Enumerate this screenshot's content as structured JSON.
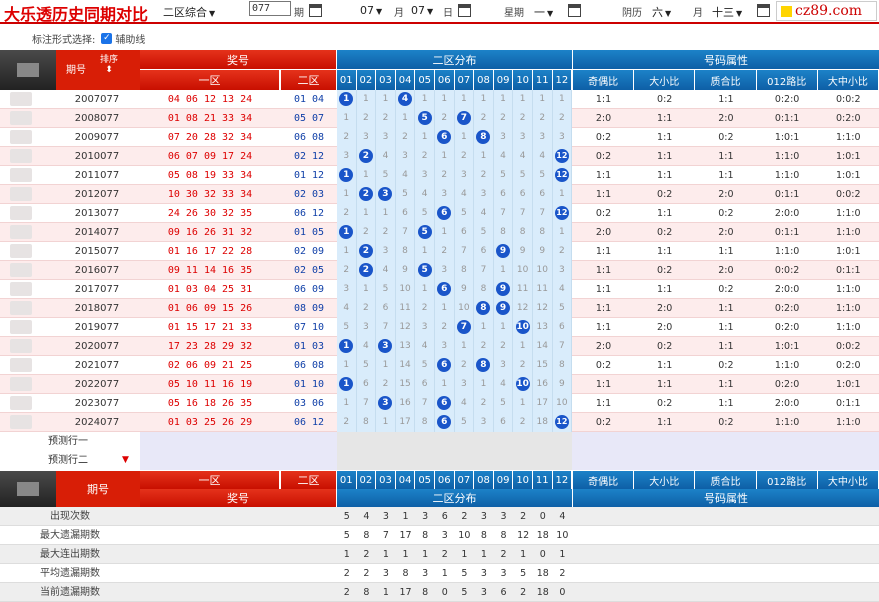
{
  "toolbar": {
    "title": "大乐透历史同期对比",
    "zone_select": "二区综合",
    "period_input": "077",
    "period_label": "期",
    "month1": "07",
    "month_label": "月",
    "day1": "07",
    "day_label": "日",
    "weekday_label": "星期",
    "weekday": "一",
    "lunar_label": "阴历",
    "lunar_month": "六",
    "lunar_month_label": "月",
    "lunar_day": "十三",
    "logo_text": "cz89.com"
  },
  "mark": {
    "label": "标注形式选择:",
    "checkbox_label": "辅助线",
    "checked": true
  },
  "header": {
    "period_col": "期号",
    "sort_label": "排序",
    "prize": "奖号",
    "zone1": "一区",
    "zone2": "二区",
    "distribution": "二区分布",
    "attributes": "号码属性",
    "numbers": [
      "01",
      "02",
      "03",
      "04",
      "05",
      "06",
      "07",
      "08",
      "09",
      "10",
      "11",
      "12"
    ],
    "attr_cols": [
      "奇偶比",
      "大小比",
      "质合比",
      "012路比",
      "大中小比"
    ]
  },
  "rows": [
    {
      "period": "2007077",
      "front": "04 06 12 13 24",
      "back": "01 04",
      "cells": [
        "1",
        "1",
        "1",
        "4",
        "1",
        "1",
        "1",
        "1",
        "1",
        "1",
        "1",
        "1"
      ],
      "balls": [
        1,
        4
      ],
      "attrs": [
        "1:1",
        "0:2",
        "1:1",
        "0:2:0",
        "0:0:2"
      ]
    },
    {
      "period": "2008077",
      "front": "01 08 21 33 34",
      "back": "05 07",
      "cells": [
        "1",
        "2",
        "2",
        "1",
        "5",
        "2",
        "7",
        "2",
        "2",
        "2",
        "2",
        "2"
      ],
      "balls": [
        5,
        7
      ],
      "attrs": [
        "2:0",
        "1:1",
        "2:0",
        "0:1:1",
        "0:2:0"
      ]
    },
    {
      "period": "2009077",
      "front": "07 20 28 32 34",
      "back": "06 08",
      "cells": [
        "2",
        "3",
        "3",
        "2",
        "1",
        "6",
        "1",
        "8",
        "3",
        "3",
        "3",
        "3"
      ],
      "balls": [
        6,
        8
      ],
      "attrs": [
        "0:2",
        "1:1",
        "0:2",
        "1:0:1",
        "1:1:0"
      ]
    },
    {
      "period": "2010077",
      "front": "06 07 09 17 24",
      "back": "02 12",
      "cells": [
        "3",
        "2",
        "4",
        "3",
        "2",
        "1",
        "2",
        "1",
        "4",
        "4",
        "4",
        "12"
      ],
      "balls": [
        2,
        12
      ],
      "attrs": [
        "0:2",
        "1:1",
        "1:1",
        "1:1:0",
        "1:0:1"
      ]
    },
    {
      "period": "2011077",
      "front": "05 08 19 33 34",
      "back": "01 12",
      "cells": [
        "1",
        "1",
        "5",
        "4",
        "3",
        "2",
        "3",
        "2",
        "5",
        "5",
        "5",
        "12"
      ],
      "balls": [
        1,
        12
      ],
      "attrs": [
        "1:1",
        "1:1",
        "1:1",
        "1:1:0",
        "1:0:1"
      ]
    },
    {
      "period": "2012077",
      "front": "10 30 32 33 34",
      "back": "02 03",
      "cells": [
        "1",
        "2",
        "3",
        "5",
        "4",
        "3",
        "4",
        "3",
        "6",
        "6",
        "6",
        "1"
      ],
      "balls": [
        2,
        3
      ],
      "attrs": [
        "1:1",
        "0:2",
        "2:0",
        "0:1:1",
        "0:0:2"
      ]
    },
    {
      "period": "2013077",
      "front": "24 26 30 32 35",
      "back": "06 12",
      "cells": [
        "2",
        "1",
        "1",
        "6",
        "5",
        "6",
        "5",
        "4",
        "7",
        "7",
        "7",
        "12"
      ],
      "balls": [
        6,
        12
      ],
      "attrs": [
        "0:2",
        "1:1",
        "0:2",
        "2:0:0",
        "1:1:0"
      ]
    },
    {
      "period": "2014077",
      "front": "09 16 26 31 32",
      "back": "01 05",
      "cells": [
        "1",
        "2",
        "2",
        "7",
        "5",
        "1",
        "6",
        "5",
        "8",
        "8",
        "8",
        "1"
      ],
      "balls": [
        1,
        5
      ],
      "attrs": [
        "2:0",
        "0:2",
        "2:0",
        "0:1:1",
        "1:1:0"
      ]
    },
    {
      "period": "2015077",
      "front": "01 16 17 22 28",
      "back": "02 09",
      "cells": [
        "1",
        "2",
        "3",
        "8",
        "1",
        "2",
        "7",
        "6",
        "9",
        "9",
        "9",
        "2"
      ],
      "balls": [
        2,
        9
      ],
      "attrs": [
        "1:1",
        "1:1",
        "1:1",
        "1:1:0",
        "1:0:1"
      ]
    },
    {
      "period": "2016077",
      "front": "09 11 14 16 35",
      "back": "02 05",
      "cells": [
        "2",
        "2",
        "4",
        "9",
        "5",
        "3",
        "8",
        "7",
        "1",
        "10",
        "10",
        "3"
      ],
      "balls": [
        2,
        5
      ],
      "attrs": [
        "1:1",
        "0:2",
        "2:0",
        "0:0:2",
        "0:1:1"
      ]
    },
    {
      "period": "2017077",
      "front": "01 03 04 25 31",
      "back": "06 09",
      "cells": [
        "3",
        "1",
        "5",
        "10",
        "1",
        "6",
        "9",
        "8",
        "9",
        "11",
        "11",
        "4"
      ],
      "balls": [
        6,
        9
      ],
      "attrs": [
        "1:1",
        "1:1",
        "0:2",
        "2:0:0",
        "1:1:0"
      ]
    },
    {
      "period": "2018077",
      "front": "01 06 09 15 26",
      "back": "08 09",
      "cells": [
        "4",
        "2",
        "6",
        "11",
        "2",
        "1",
        "10",
        "8",
        "9",
        "12",
        "12",
        "5"
      ],
      "balls": [
        8,
        9
      ],
      "attrs": [
        "1:1",
        "2:0",
        "1:1",
        "0:2:0",
        "1:1:0"
      ]
    },
    {
      "period": "2019077",
      "front": "01 15 17 21 33",
      "back": "07 10",
      "cells": [
        "5",
        "3",
        "7",
        "12",
        "3",
        "2",
        "7",
        "1",
        "1",
        "10",
        "13",
        "6"
      ],
      "balls": [
        7,
        10
      ],
      "attrs": [
        "1:1",
        "2:0",
        "1:1",
        "0:2:0",
        "1:1:0"
      ]
    },
    {
      "period": "2020077",
      "front": "17 23 28 29 32",
      "back": "01 03",
      "cells": [
        "1",
        "4",
        "3",
        "13",
        "4",
        "3",
        "1",
        "2",
        "2",
        "1",
        "14",
        "7"
      ],
      "balls": [
        1,
        3
      ],
      "attrs": [
        "2:0",
        "0:2",
        "1:1",
        "1:0:1",
        "0:0:2"
      ]
    },
    {
      "period": "2021077",
      "front": "02 06 09 21 25",
      "back": "06 08",
      "cells": [
        "1",
        "5",
        "1",
        "14",
        "5",
        "6",
        "2",
        "8",
        "3",
        "2",
        "15",
        "8"
      ],
      "balls": [
        6,
        8
      ],
      "attrs": [
        "0:2",
        "1:1",
        "0:2",
        "1:1:0",
        "0:2:0"
      ]
    },
    {
      "period": "2022077",
      "front": "05 10 11 16 19",
      "back": "01 10",
      "cells": [
        "1",
        "6",
        "2",
        "15",
        "6",
        "1",
        "3",
        "1",
        "4",
        "10",
        "16",
        "9"
      ],
      "balls": [
        1,
        10
      ],
      "attrs": [
        "1:1",
        "1:1",
        "1:1",
        "0:2:0",
        "1:0:1"
      ]
    },
    {
      "period": "2023077",
      "front": "05 16 18 26 35",
      "back": "03 06",
      "cells": [
        "1",
        "7",
        "3",
        "16",
        "7",
        "6",
        "4",
        "2",
        "5",
        "1",
        "17",
        "10"
      ],
      "balls": [
        3,
        6
      ],
      "attrs": [
        "1:1",
        "0:2",
        "1:1",
        "2:0:0",
        "0:1:1"
      ]
    },
    {
      "period": "2024077",
      "front": "01 03 25 26 29",
      "back": "06 12",
      "cells": [
        "2",
        "8",
        "1",
        "17",
        "8",
        "6",
        "5",
        "3",
        "6",
        "2",
        "18",
        "12"
      ],
      "balls": [
        6,
        12
      ],
      "attrs": [
        "0:2",
        "1:1",
        "0:2",
        "1:1:0",
        "1:1:0"
      ]
    }
  ],
  "predict": [
    "预测行一",
    "预测行二"
  ],
  "footer_header": {
    "period_col": "期号",
    "prize": "奖号",
    "zone1": "一区",
    "zone2": "二区",
    "distribution": "二区分布",
    "attributes": "号码属性"
  },
  "stats": [
    {
      "label": "出现次数",
      "values": [
        "5",
        "4",
        "3",
        "1",
        "3",
        "6",
        "2",
        "3",
        "3",
        "2",
        "0",
        "4"
      ]
    },
    {
      "label": "最大遗漏期数",
      "values": [
        "5",
        "8",
        "7",
        "17",
        "8",
        "3",
        "10",
        "8",
        "8",
        "12",
        "18",
        "10"
      ]
    },
    {
      "label": "最大连出期数",
      "values": [
        "1",
        "2",
        "1",
        "1",
        "1",
        "2",
        "1",
        "1",
        "2",
        "1",
        "0",
        "1"
      ]
    },
    {
      "label": "平均遗漏期数",
      "values": [
        "2",
        "2",
        "3",
        "8",
        "3",
        "1",
        "5",
        "3",
        "3",
        "5",
        "18",
        "2"
      ]
    },
    {
      "label": "当前遗漏期数",
      "values": [
        "2",
        "8",
        "1",
        "17",
        "8",
        "0",
        "5",
        "3",
        "6",
        "2",
        "18",
        "0"
      ]
    }
  ],
  "colors": {
    "accent_red": "#d81e06",
    "accent_blue": "#0e5fa6",
    "ball_blue": "#1a55c9"
  }
}
